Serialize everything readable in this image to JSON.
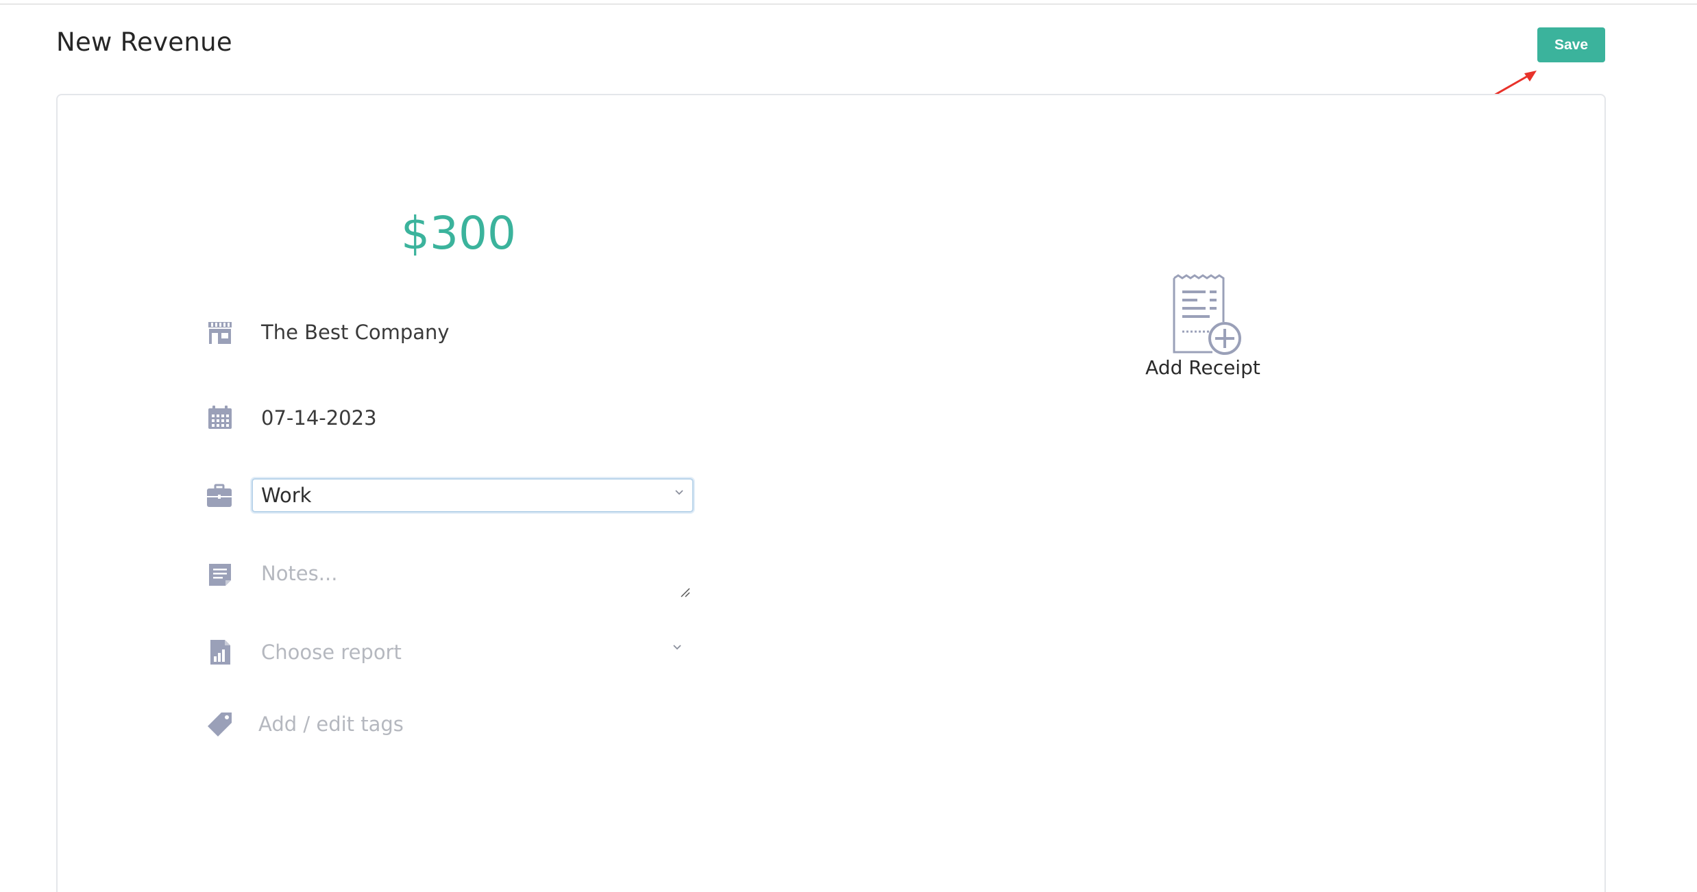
{
  "header": {
    "title": "New Revenue",
    "save_label": "Save"
  },
  "form": {
    "amount": "$300",
    "merchant": "The Best Company",
    "date": "07-14-2023",
    "category": {
      "selected": "Work"
    },
    "notes": {
      "placeholder": "Notes..."
    },
    "report": {
      "placeholder": "Choose report"
    },
    "tags": {
      "placeholder": "Add / edit tags"
    }
  },
  "receipt": {
    "label": "Add Receipt"
  },
  "icons": {
    "merchant": "storefront-icon",
    "date": "calendar-icon",
    "category": "briefcase-icon",
    "notes": "note-icon",
    "report": "report-chart-icon",
    "tags": "tag-icon",
    "receipt": "receipt-add-icon"
  },
  "colors": {
    "accent": "#3bb39c",
    "icon": "#9aa0b8",
    "annotation": "#e8322a"
  }
}
